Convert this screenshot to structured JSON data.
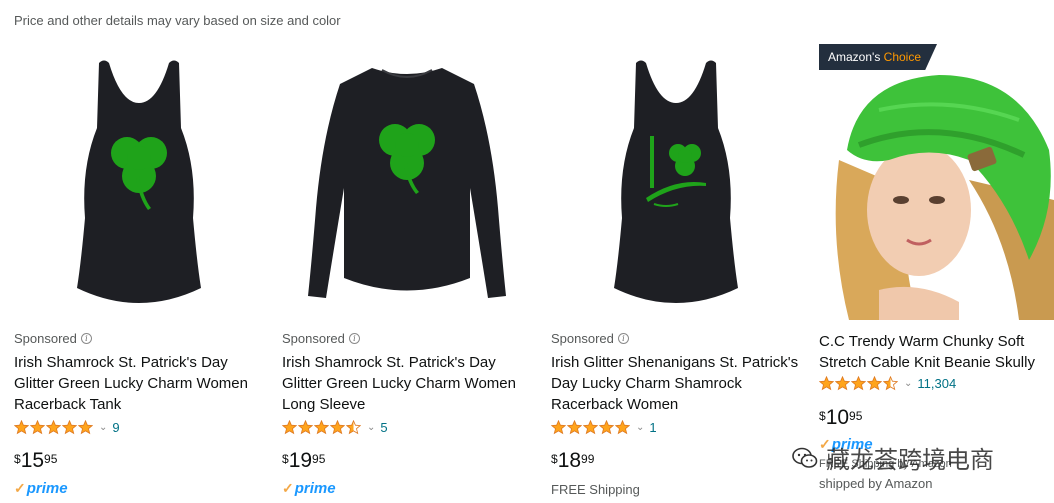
{
  "notice": "Price and other details may vary based on size and color",
  "colors": {
    "link": "#007185",
    "star": "#ffa41c",
    "prime_blue": "#1a98ff",
    "prime_check": "#f3a847",
    "badge_bg": "#232f3e",
    "badge_accent": "#ff9900",
    "shamrock": "#1fa31a",
    "garment": "#1e1f24",
    "beanie": "#3ec23a"
  },
  "products": [
    {
      "sponsored": "Sponsored",
      "title": "Irish Shamrock St. Patrick's Day Glitter Green Lucky Charm Women Racerback Tank",
      "rating": 5,
      "review_count": "9",
      "price": {
        "symbol": "$",
        "whole": "15",
        "fraction": "95"
      },
      "delivery": "prime",
      "image_icon": "racerback-tank-shamrock-image"
    },
    {
      "sponsored": "Sponsored",
      "title": "Irish Shamrock St. Patrick's Day Glitter Green Lucky Charm Women Long Sleeve",
      "rating": 4.5,
      "review_count": "5",
      "price": {
        "symbol": "$",
        "whole": "19",
        "fraction": "95"
      },
      "delivery": "prime",
      "image_icon": "long-sleeve-shamrock-image"
    },
    {
      "sponsored": "Sponsored",
      "title": "Irish Glitter Shenanigans St. Patrick's Day Lucky Charm Shamrock Racerback Women",
      "rating": 5,
      "review_count": "1",
      "price": {
        "symbol": "$",
        "whole": "18",
        "fraction": "99"
      },
      "delivery": "FREE Shipping",
      "image_icon": "shenanigans-tank-image"
    },
    {
      "badge_prefix": "Amazon's",
      "badge_suffix": "Choice",
      "title": "C.C Trendy Warm Chunky Soft Stretch Cable Knit Beanie Skully",
      "rating": 4.5,
      "review_count": "11,304",
      "price": {
        "symbol": "$",
        "whole": "10",
        "fraction": "95"
      },
      "delivery": "prime",
      "fulfilled": "FREE Shipping by Amazon",
      "shipped": "shipped by Amazon",
      "image_icon": "green-beanie-model-image"
    }
  ],
  "prime_label": "prime",
  "watermark": "藏龙荟跨境电商"
}
